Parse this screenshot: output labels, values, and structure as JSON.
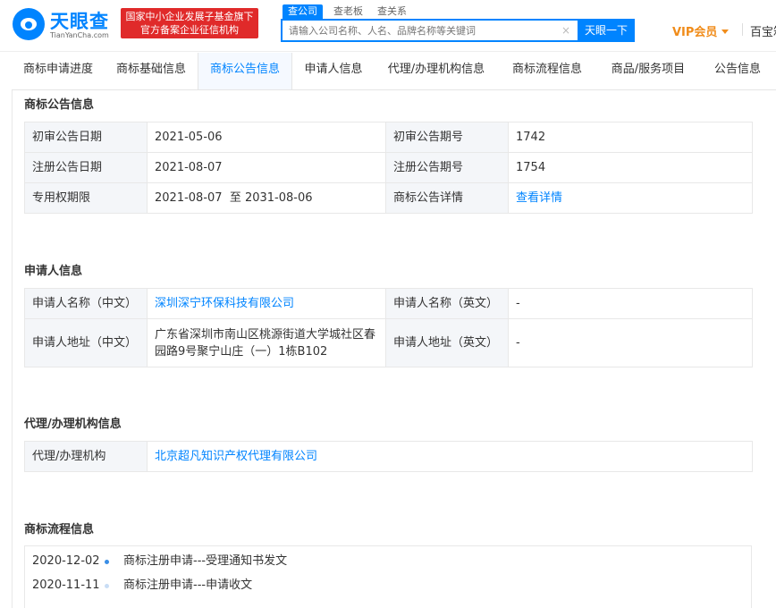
{
  "header": {
    "logo_cn": "天眼查",
    "logo_en": "TianYanCha.com",
    "slogan_line1": "国家中小企业发展子基金旗下",
    "slogan_line2": "官方备案企业征信机构",
    "search_tabs": [
      "查公司",
      "查老板",
      "查关系"
    ],
    "search_placeholder": "请输入公司名称、人名、品牌名称等关键词",
    "search_button": "天眼一下",
    "vip_label": "VIP会员",
    "baibao": "百宝箱"
  },
  "nav": {
    "tabs": [
      "商标申请进度",
      "商标基础信息",
      "商标公告信息",
      "申请人信息",
      "代理/办理机构信息",
      "商标流程信息",
      "商品/服务项目",
      "公告信息"
    ],
    "active_index": 2
  },
  "announcement": {
    "title": "商标公告信息",
    "rows": [
      [
        "初审公告日期",
        "2021-05-06",
        "初审公告期号",
        "1742"
      ],
      [
        "注册公告日期",
        "2021-08-07",
        "注册公告期号",
        "1754"
      ],
      [
        "专用权期限",
        "2021-08-07  至 2031-08-06",
        "商标公告详情",
        "查看详情"
      ]
    ]
  },
  "applicant": {
    "title": "申请人信息",
    "rows": [
      [
        "申请人名称（中文）",
        "深圳深宁环保科技有限公司",
        "申请人名称（英文）",
        "-"
      ],
      [
        "申请人地址（中文）",
        "广东省深圳市南山区桃源街道大学城社区春园路9号聚宁山庄（一）1栋B102",
        "申请人地址（英文）",
        "-"
      ]
    ]
  },
  "agent": {
    "title": "代理/办理机构信息",
    "label": "代理/办理机构",
    "value": "北京超凡知识产权代理有限公司"
  },
  "flow": {
    "title": "商标流程信息",
    "items": [
      {
        "date": "2020-12-02",
        "text": "商标注册申请---受理通知书发文",
        "dot_color": "#3a8ee6"
      },
      {
        "date": "2020-11-11",
        "text": "商标注册申请---申请收文",
        "dot_color": "#c9ddf5"
      }
    ]
  },
  "colors": {
    "brand": "#0084ff",
    "slogan_bg": "#e02a2a",
    "vip": "#f08c1a",
    "label_bg": "#f4f6f9"
  }
}
